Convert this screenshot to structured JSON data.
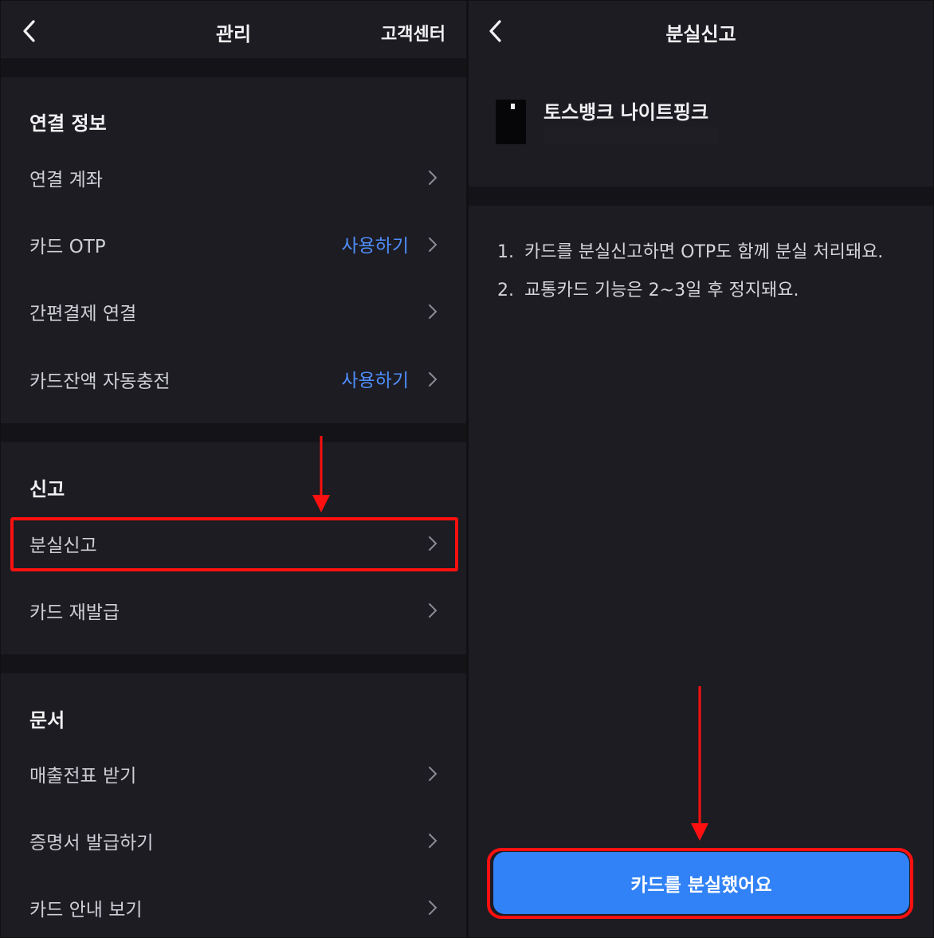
{
  "left": {
    "header": {
      "title": "관리",
      "help_label": "고객센터",
      "back_icon": "chevron-left-icon"
    },
    "sections": [
      {
        "title": "연결 정보",
        "items": [
          {
            "label": "연결 계좌",
            "action": ""
          },
          {
            "label": "카드 OTP",
            "action": "사용하기"
          },
          {
            "label": "간편결제 연결",
            "action": ""
          },
          {
            "label": "카드잔액 자동충전",
            "action": "사용하기"
          }
        ]
      },
      {
        "title": "신고",
        "items": [
          {
            "label": "분실신고",
            "action": ""
          },
          {
            "label": "카드 재발급",
            "action": ""
          }
        ]
      },
      {
        "title": "문서",
        "items": [
          {
            "label": "매출전표 받기",
            "action": ""
          },
          {
            "label": "증명서 발급하기",
            "action": ""
          },
          {
            "label": "카드 안내 보기",
            "action": ""
          }
        ]
      }
    ]
  },
  "right": {
    "header": {
      "title": "분실신고",
      "back_icon": "chevron-left-icon"
    },
    "card": {
      "name": "토스뱅크 나이트핑크"
    },
    "notices": [
      {
        "num": "1.",
        "text": "카드를 분실신고하면 OTP도 함께 분실 처리돼요."
      },
      {
        "num": "2.",
        "text": "교통카드 기능은 2~3일 후 정지돼요."
      }
    ],
    "cta_label": "카드를 분실했어요"
  },
  "colors": {
    "accent": "#3182f6",
    "link": "#4f8dfc",
    "highlight": "#ff1010",
    "background": "#1c1c22"
  }
}
